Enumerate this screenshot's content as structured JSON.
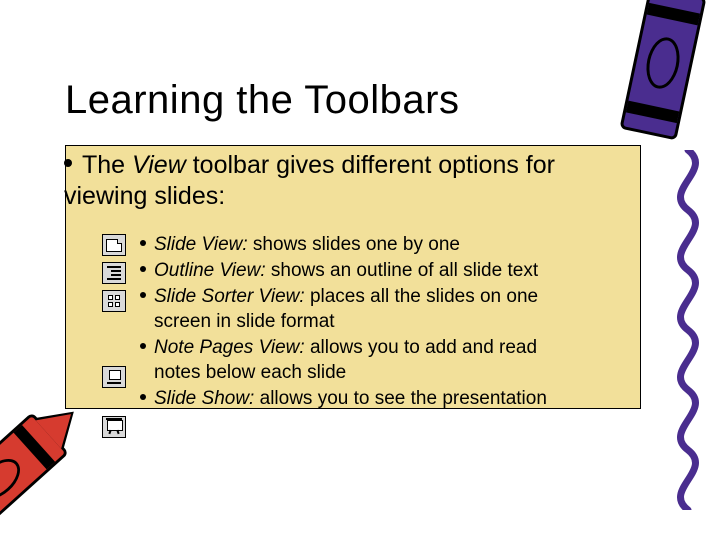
{
  "title": "Learning the Toolbars",
  "intro": {
    "pre": "The ",
    "em": "View",
    "post": " toolbar gives different options for viewing slides:"
  },
  "items": [
    {
      "em": "Slide View:",
      "rest": " shows slides one by one"
    },
    {
      "em": "Outline View:",
      "rest": " shows an outline of all slide text"
    },
    {
      "em": "Slide Sorter View:",
      "rest": " places all the slides on one",
      "cont": "screen in slide format"
    },
    {
      "em": "Note Pages View:",
      "rest": " allows you to add and read",
      "cont": "notes below each slide"
    },
    {
      "em": "Slide Show:",
      "rest": "  allows you to see the presentation"
    }
  ]
}
